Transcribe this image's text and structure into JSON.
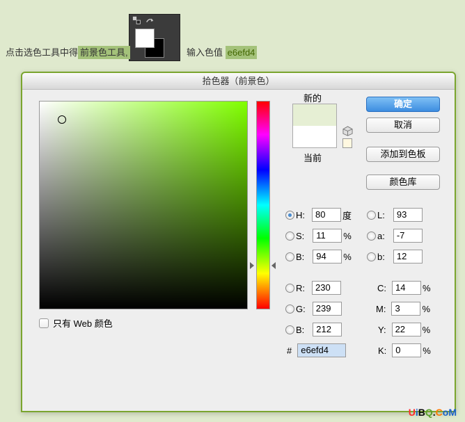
{
  "top": {
    "instr_prefix": "点击选色工具中得",
    "instr_highlight": "前景色工具,",
    "input_label": "输入色值",
    "input_value": "e6efd4"
  },
  "dialog": {
    "title": "拾色器（前景色）",
    "new_label": "新的",
    "current_label": "当前",
    "buttons": {
      "ok": "确定",
      "cancel": "取消",
      "add_swatch": "添加到色板",
      "color_lib": "颜色库"
    },
    "web_only": "只有 Web 颜色",
    "hsb": {
      "H": {
        "label": "H:",
        "value": "80",
        "unit": "度"
      },
      "S": {
        "label": "S:",
        "value": "11",
        "unit": "%"
      },
      "B": {
        "label": "B:",
        "value": "94",
        "unit": "%"
      }
    },
    "rgb": {
      "R": {
        "label": "R:",
        "value": "230"
      },
      "G": {
        "label": "G:",
        "value": "239"
      },
      "B": {
        "label": "B:",
        "value": "212"
      }
    },
    "lab": {
      "L": {
        "label": "L:",
        "value": "93"
      },
      "a": {
        "label": "a:",
        "value": "-7"
      },
      "b": {
        "label": "b:",
        "value": "12"
      }
    },
    "cmyk": {
      "C": {
        "label": "C:",
        "value": "14",
        "unit": "%"
      },
      "M": {
        "label": "M:",
        "value": "3",
        "unit": "%"
      },
      "Y": {
        "label": "Y:",
        "value": "22",
        "unit": "%"
      },
      "K": {
        "label": "K:",
        "value": "0",
        "unit": "%"
      }
    },
    "hex": {
      "hash": "#",
      "value": "e6efd4"
    }
  },
  "watermark": {
    "u": "U",
    "i": "i",
    "b": "B",
    "q": "Q",
    "dot": ".",
    "c": "C",
    "om": "oM"
  }
}
